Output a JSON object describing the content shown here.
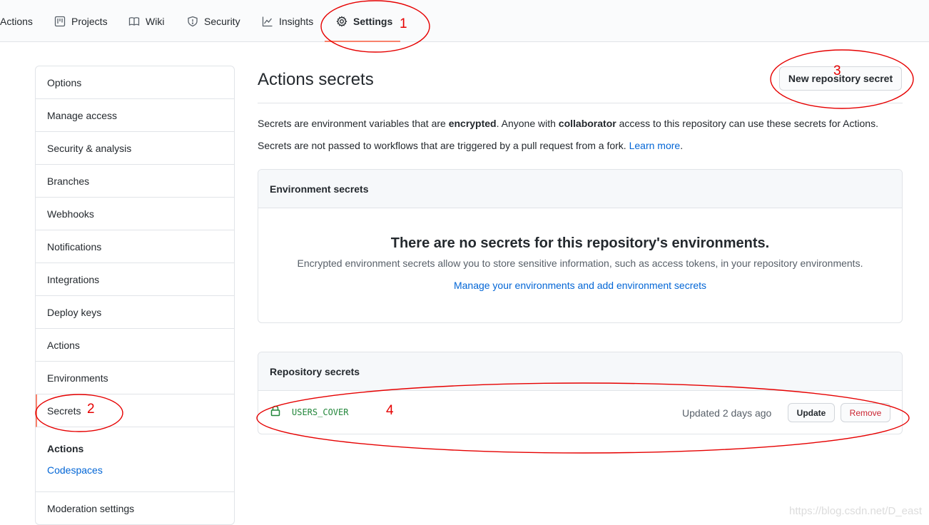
{
  "repo_nav": {
    "tabs": [
      {
        "label": "Actions",
        "icon": "play-icon"
      },
      {
        "label": "Projects",
        "icon": "project-icon"
      },
      {
        "label": "Wiki",
        "icon": "book-icon"
      },
      {
        "label": "Security",
        "icon": "shield-icon"
      },
      {
        "label": "Insights",
        "icon": "graph-icon"
      },
      {
        "label": "Settings",
        "icon": "gear-icon",
        "active": true
      }
    ]
  },
  "sidebar": {
    "items": [
      {
        "label": "Options"
      },
      {
        "label": "Manage access"
      },
      {
        "label": "Security & analysis"
      },
      {
        "label": "Branches"
      },
      {
        "label": "Webhooks"
      },
      {
        "label": "Notifications"
      },
      {
        "label": "Integrations"
      },
      {
        "label": "Deploy keys"
      },
      {
        "label": "Actions"
      },
      {
        "label": "Environments"
      },
      {
        "label": "Secrets",
        "selected": true
      }
    ],
    "group_heading": "Actions",
    "group_link": "Codespaces",
    "footer_item": "Moderation settings"
  },
  "main": {
    "title": "Actions secrets",
    "new_secret_button": "New repository secret",
    "intro": {
      "line1_part1": "Secrets are environment variables that are ",
      "line1_bold1": "encrypted",
      "line1_part2": ". Anyone with ",
      "line1_bold2": "collaborator",
      "line1_part3": " access to this repository can use these secrets for Actions.",
      "line2_text": "Secrets are not passed to workflows that are triggered by a pull request from a fork. ",
      "line2_link": "Learn more",
      "line2_end": "."
    },
    "environment_secrets": {
      "header": "Environment secrets",
      "empty_title": "There are no secrets for this repository's environments.",
      "empty_description": "Encrypted environment secrets allow you to store sensitive information, such as access tokens, in your repository environments.",
      "manage_link": "Manage your environments and add environment secrets"
    },
    "repository_secrets": {
      "header": "Repository secrets",
      "rows": [
        {
          "name": "USERS_COVER",
          "updated": "Updated 2 days ago",
          "update_label": "Update",
          "remove_label": "Remove"
        }
      ]
    }
  },
  "annotations": {
    "marks": [
      "1",
      "2",
      "3",
      "4"
    ],
    "color": "#e60000"
  },
  "watermark": "https://blog.csdn.net/D_east",
  "colors": {
    "accent_underline": "#f9826c",
    "link": "#0366d6",
    "secret_name": "#22863a",
    "danger": "#cb2431"
  }
}
